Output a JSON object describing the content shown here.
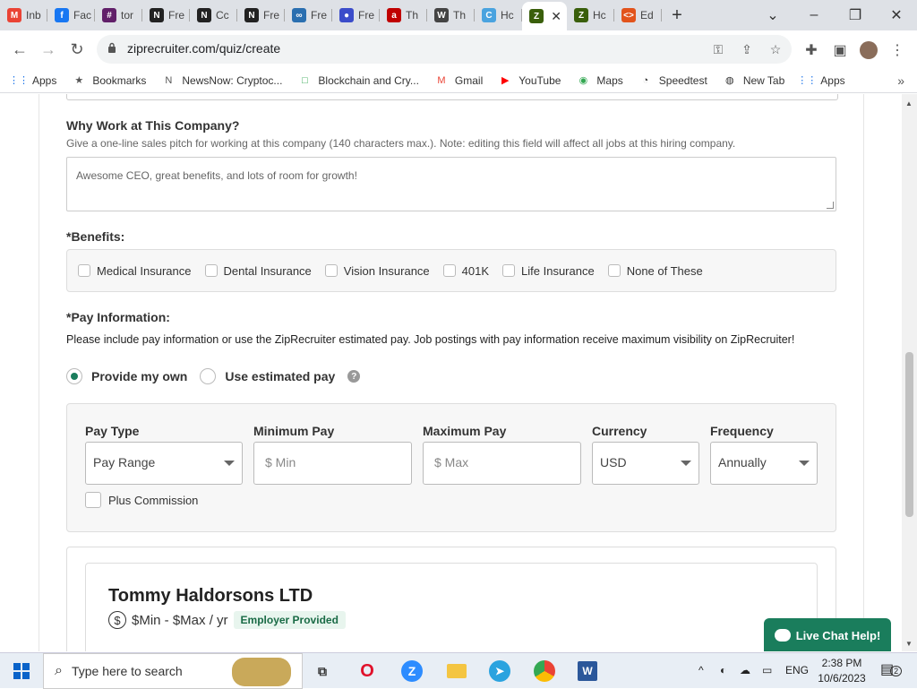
{
  "browser": {
    "tabs": [
      {
        "label": "Inb",
        "icon": "gmail-icon",
        "color": "#ea4335",
        "glyph": "M"
      },
      {
        "label": "Fac",
        "icon": "facebook-icon",
        "color": "#1877f2",
        "glyph": "f"
      },
      {
        "label": "tor",
        "icon": "slack-icon",
        "color": "#611f69",
        "glyph": "#"
      },
      {
        "label": "Fre",
        "icon": "notion-icon",
        "color": "#222222",
        "glyph": "N"
      },
      {
        "label": "Cc",
        "icon": "notion-icon",
        "color": "#222222",
        "glyph": "N"
      },
      {
        "label": "Fre",
        "icon": "notion-icon",
        "color": "#222222",
        "glyph": "N"
      },
      {
        "label": "Fre",
        "icon": "link-icon",
        "color": "#2a6fb0",
        "glyph": "∞"
      },
      {
        "label": "Fre",
        "icon": "globe-icon",
        "color": "#3b4cca",
        "glyph": "●"
      },
      {
        "label": "Th",
        "icon": "news-icon",
        "color": "#c00000",
        "glyph": "a"
      },
      {
        "label": "Th",
        "icon": "wordpress-icon",
        "color": "#444444",
        "glyph": "W"
      },
      {
        "label": "Hc",
        "icon": "swirl-icon",
        "color": "#4aa3df",
        "glyph": "C"
      },
      {
        "label": "Hc",
        "icon": "ziprecruiter-icon",
        "color": "#3a5f0b",
        "glyph": "Z"
      },
      {
        "label": "Ed",
        "icon": "code-icon",
        "color": "#e2531b",
        "glyph": "<>"
      }
    ],
    "active_tab": {
      "icon": "ziprecruiter-icon",
      "color": "#3a5f0b",
      "glyph": "Z",
      "close": "✕"
    },
    "new_tab": "+",
    "url": "ziprecruiter.com/quiz/create"
  },
  "bookmarks": [
    {
      "label": "Apps",
      "icon": "apps-grid-icon",
      "glyph": "⋮⋮",
      "color": "#1a73e8"
    },
    {
      "label": "Bookmarks",
      "icon": "star-icon",
      "glyph": "★",
      "color": "#555555"
    },
    {
      "label": "NewsNow: Cryptoc...",
      "icon": "newsnow-icon",
      "glyph": "N",
      "color": "#555555"
    },
    {
      "label": "Blockchain and Cry...",
      "icon": "blockchain-icon",
      "glyph": "□",
      "color": "#34a853"
    },
    {
      "label": "Gmail",
      "icon": "gmail-icon",
      "glyph": "M",
      "color": "#ea4335"
    },
    {
      "label": "YouTube",
      "icon": "youtube-icon",
      "glyph": "▶",
      "color": "#ff0000"
    },
    {
      "label": "Maps",
      "icon": "maps-pin-icon",
      "glyph": "◉",
      "color": "#34a853"
    },
    {
      "label": "Speedtest",
      "icon": "speedtest-icon",
      "glyph": "◔",
      "color": "#333333"
    },
    {
      "label": "New Tab",
      "icon": "globe-icon",
      "glyph": "◍",
      "color": "#333333"
    },
    {
      "label": "Apps",
      "icon": "apps-grid-icon",
      "glyph": "⋮⋮",
      "color": "#1a73e8"
    }
  ],
  "form": {
    "why_work": {
      "title": "Why Work at This Company?",
      "hint": "Give a one-line sales pitch for working at this company (140 characters max.). Note: editing this field will affect all jobs at this hiring company.",
      "value": "Awesome CEO, great benefits, and lots of room for growth!"
    },
    "benefits": {
      "title": "*Benefits:",
      "options": [
        "Medical Insurance",
        "Dental Insurance",
        "Vision Insurance",
        "401K",
        "Life Insurance",
        "None of These"
      ]
    },
    "pay": {
      "title": "*Pay Information:",
      "description": "Please include pay information or use the ZipRecruiter estimated pay. Job postings with pay information receive maximum visibility on ZipRecruiter!",
      "radio_own": "Provide my own",
      "radio_estimated": "Use estimated pay",
      "help_glyph": "?",
      "pay_type_label": "Pay Type",
      "pay_type_value": "Pay Range",
      "min_label": "Minimum Pay",
      "min_placeholder": "$ Min",
      "max_label": "Maximum Pay",
      "max_placeholder": "$ Max",
      "currency_label": "Currency",
      "currency_value": "USD",
      "frequency_label": "Frequency",
      "frequency_value": "Annually",
      "commission_label": "Plus Commission"
    },
    "preview": {
      "company": "Tommy Haldorsons LTD",
      "dollar_glyph": "$",
      "salary": "$Min - $Max / yr",
      "badge": "Employer Provided"
    }
  },
  "live_chat": "Live Chat Help!",
  "taskbar": {
    "search_placeholder": "Type here to search",
    "language": "ENG",
    "time": "2:38 PM",
    "date": "10/6/2023",
    "notifications": "2"
  },
  "colors": {
    "accent": "#1a7d5c",
    "badge_bg": "#e8f5ee"
  }
}
